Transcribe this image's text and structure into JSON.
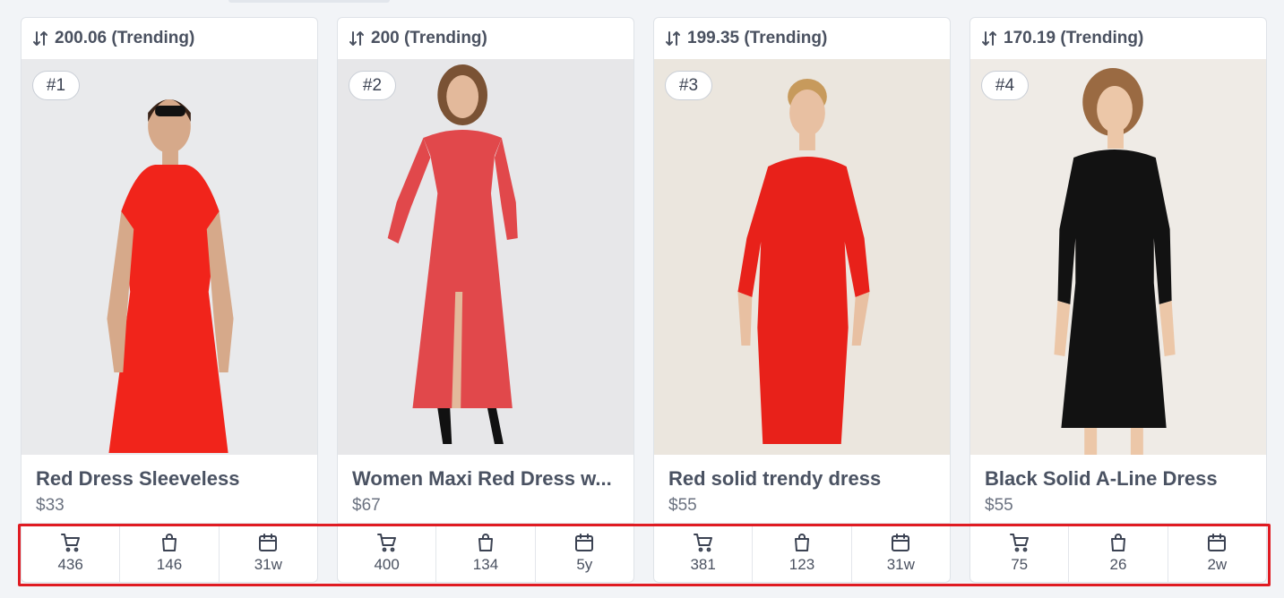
{
  "products": [
    {
      "score": "200.06 (Trending)",
      "rank": "#1",
      "title": "Red Dress Sleeveless",
      "price": "$33",
      "stats": {
        "cart": "436",
        "bag": "146",
        "age": "31w"
      },
      "photo": {
        "bg": "#e9eaec",
        "dress": "#f1241b",
        "style": "sleeveless"
      }
    },
    {
      "score": "200 (Trending)",
      "rank": "#2",
      "title": "Women Maxi Red Dress w...",
      "price": "$67",
      "stats": {
        "cart": "400",
        "bag": "134",
        "age": "5y"
      },
      "photo": {
        "bg": "#e7e7e9",
        "dress": "#e1484b",
        "style": "maxi"
      }
    },
    {
      "score": "199.35 (Trending)",
      "rank": "#3",
      "title": "Red solid trendy dress",
      "price": "$55",
      "stats": {
        "cart": "381",
        "bag": "123",
        "age": "31w"
      },
      "photo": {
        "bg": "#ebe6de",
        "dress": "#e8211a",
        "style": "sleeved"
      }
    },
    {
      "score": "170.19 (Trending)",
      "rank": "#4",
      "title": "Black Solid A-Line Dress",
      "price": "$55",
      "stats": {
        "cart": "75",
        "bag": "26",
        "age": "2w"
      },
      "photo": {
        "bg": "#efebe6",
        "dress": "#121212",
        "style": "sleeved"
      }
    }
  ],
  "icons": {
    "score": "sort-arrows-icon",
    "cart": "shopping-cart-icon",
    "bag": "shopping-bag-icon",
    "age": "calendar-icon"
  },
  "colors": {
    "highlight": "#e01b22",
    "page_bg": "#f2f4f7"
  }
}
